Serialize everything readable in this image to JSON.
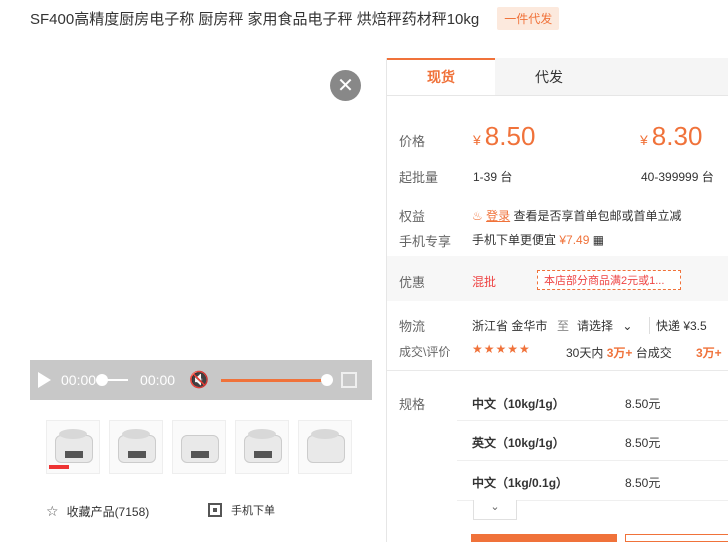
{
  "product": {
    "title": "SF400高精度厨房电子称 厨房秤 家用食品电子秤 烘焙秤药材秤10kg",
    "badge": "一件代发"
  },
  "player": {
    "current_time": "00:00",
    "duration": "00:00",
    "close_icon": "close-icon",
    "volume_level": 1.0
  },
  "thumbnails": [
    "thumb-1",
    "thumb-2",
    "thumb-3",
    "thumb-4",
    "thumb-5"
  ],
  "actions": {
    "favorite_label": "收藏产品(7158)",
    "mobile_order_label": "手机下单"
  },
  "tabs": [
    {
      "label": "现货",
      "active": true
    },
    {
      "label": "代发",
      "active": false
    }
  ],
  "pricing": {
    "price_label": "价格",
    "currency": "¥",
    "tiers": [
      {
        "price": "8.50",
        "range": "1-39 台"
      },
      {
        "price": "8.30",
        "range": "40-399999 台"
      }
    ],
    "moq_label": "起批量"
  },
  "benefits": {
    "label": "权益",
    "login_text": "登录",
    "login_desc": "查看是否享首单包邮或首单立减",
    "mobile_label": "手机专享",
    "mobile_desc": "手机下单更便宜",
    "mobile_price": "¥7.49"
  },
  "promotion": {
    "label": "优惠",
    "type": "混批",
    "tag": "本店部分商品满2元或1..."
  },
  "logistics": {
    "label": "物流",
    "origin": "浙江省 金华市",
    "to": "至",
    "destination": "请选择",
    "express": "快递 ¥3.5"
  },
  "reviews": {
    "label": "成交\\评价",
    "stars": "★★★★★",
    "sales_prefix": "30天内",
    "sales_count": "3万+",
    "sales_suffix": "台成交",
    "extra": "3万+"
  },
  "specs": {
    "label": "规格",
    "items": [
      {
        "name": "中文（10kg/1g）",
        "price": "8.50元"
      },
      {
        "name": "英文（10kg/1g）",
        "price": "8.50元"
      },
      {
        "name": "中文（1kg/0.1g）",
        "price": "8.50元"
      }
    ],
    "more_icon": "chevron-down-icon"
  },
  "colors": {
    "accent": "#f0723a"
  }
}
